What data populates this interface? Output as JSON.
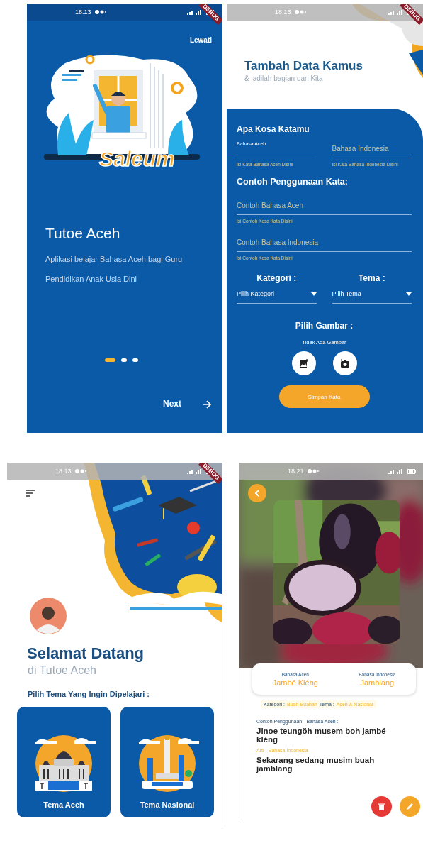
{
  "onboarding": {
    "status_time": "18.13",
    "debug_banner": "DEBUG",
    "skip_label": "Lewati",
    "logo_text": "Saleum",
    "title": "Tutoe Aceh",
    "description": "Aplikasi belajar Bahasa Aceh bagi Guru Pendidikan Anak Usia Dini",
    "dots": [
      {
        "selected": true
      },
      {
        "selected": false
      },
      {
        "selected": false
      }
    ],
    "next_label": "Next"
  },
  "add_word": {
    "status_time": "18.13",
    "debug_banner": "DEBUG",
    "title": "Tambah Data Kamus",
    "subtitle": "& jadilah bagian dari Kita",
    "word_heading": "Apa Kosa Katamu",
    "word_fields": [
      {
        "label": "Bahasa Aceh",
        "focused": true,
        "helper": "Isi Kata Bahasa Aceh Disini"
      },
      {
        "placeholder": "Bahasa Indonesia",
        "focused": false,
        "helper": "Isi Kata Bahasa Indonesia Disini"
      }
    ],
    "example_heading": "Contoh Penggunaan Kata:",
    "example_fields": [
      {
        "placeholder": "Contoh Bahasa Aceh",
        "focused": false,
        "helper": "Isi Contoh Kosa Kata Disini"
      },
      {
        "placeholder": "Contoh Bahasa Indonesia",
        "focused": false,
        "helper": "Isi Contoh Kosa Kata Disini"
      }
    ],
    "dropdowns": [
      {
        "heading": "Kategori :",
        "value": "Pilih Kategori"
      },
      {
        "heading": "Tema :",
        "value": "Pilih Tema"
      }
    ],
    "image_heading": "Pilih Gambar :",
    "image_status": "Tidak Ada Gambar",
    "save_button": "Simpan Kata"
  },
  "home": {
    "status_time": "18.13",
    "debug_banner": "DEBUG",
    "greeting": "Selamat Datang",
    "subtitle": "di Tutoe Aceh",
    "prompt": "Pilih Tema Yang Ingin Dipelajari :",
    "themes": [
      {
        "label": "Tema Aceh",
        "kind": "mosque"
      },
      {
        "label": "Tema Nasional",
        "kind": "monument"
      }
    ]
  },
  "detail": {
    "status_time": "18.21",
    "words": [
      {
        "language": "Bahasa Aceh",
        "word": "Jambé Kléng"
      },
      {
        "language": "Bahasa Indonesia",
        "word": "Jamblang"
      }
    ],
    "category_label": "Kategori :",
    "category": "Buah-Buahan",
    "theme_label": "Tema :",
    "theme": "Aceh & Nasional",
    "example_label": "Contoh Penggunaan - Bahasa Aceh :",
    "example": "Jinoe teungöh musem boh jambé kléng",
    "meaning_label": "Arti - Bahasa Indonesia",
    "meaning": "Sekarang sedang musim buah jamblang"
  }
}
